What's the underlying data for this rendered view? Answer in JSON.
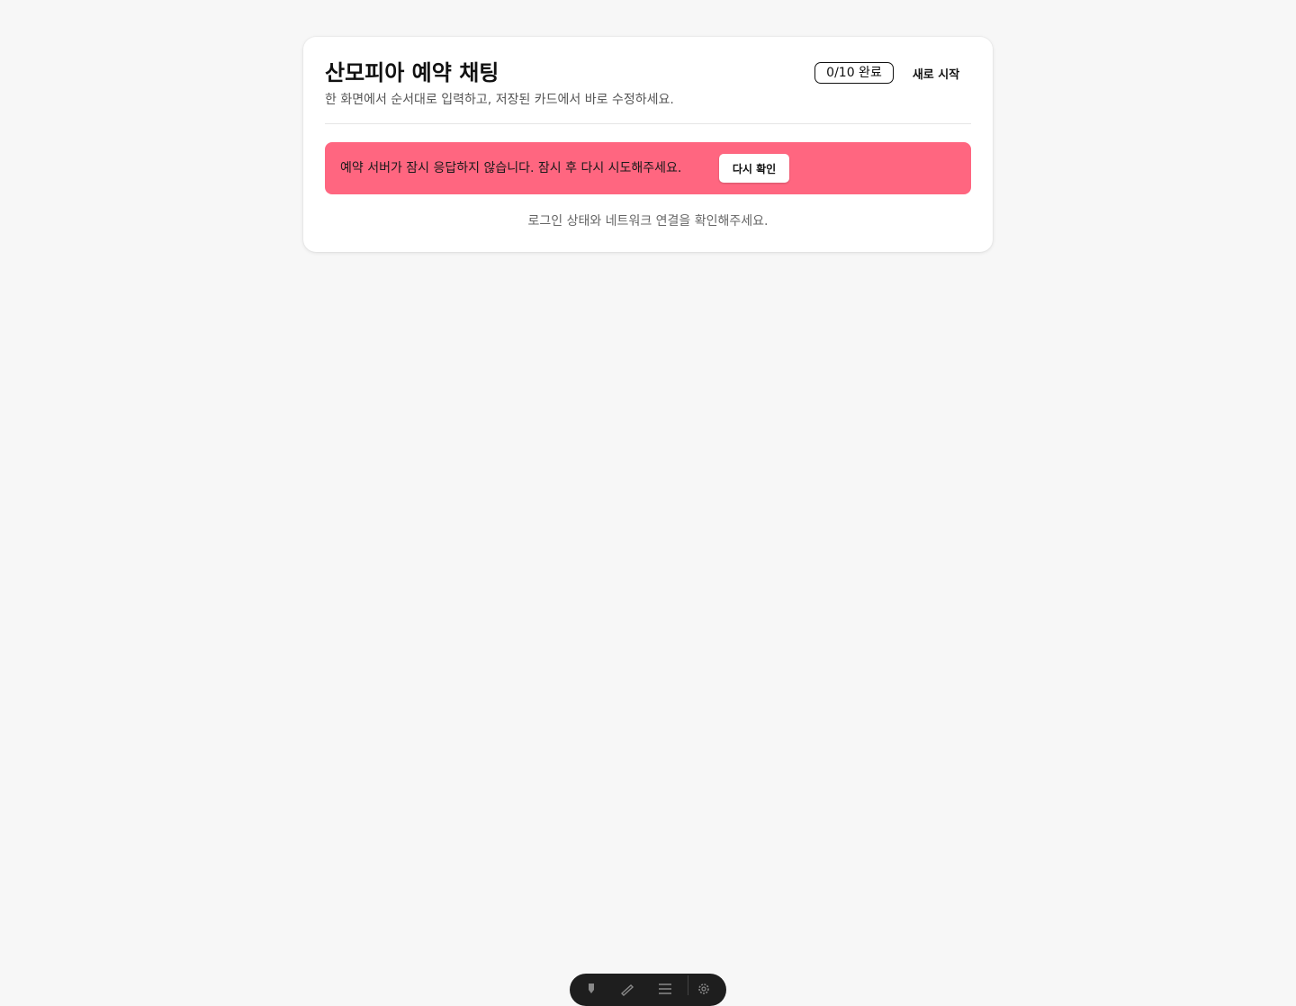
{
  "header": {
    "title": "산모피아 예약 채팅",
    "subtitle": "한 화면에서 순서대로 입력하고, 저장된 카드에서 바로 수정하세요.",
    "progress": "0/10 완료",
    "restart_label": "새로 시작"
  },
  "error": {
    "message": "예약 서버가 잠시 응답하지 않습니다. 잠시 후 다시 시도해주세요.",
    "retry_label": "다시 확인"
  },
  "hint": "로그인 상태와 네트워크 연결을 확인해주세요.",
  "colors": {
    "background": "#f7f7f7",
    "card": "#ffffff",
    "error_banner": "#ff6680",
    "toolbar": "#1e1e1e"
  },
  "toolbar": {
    "icons": [
      "pointer-icon",
      "pen-icon",
      "menu-icon",
      "settings-icon"
    ]
  }
}
